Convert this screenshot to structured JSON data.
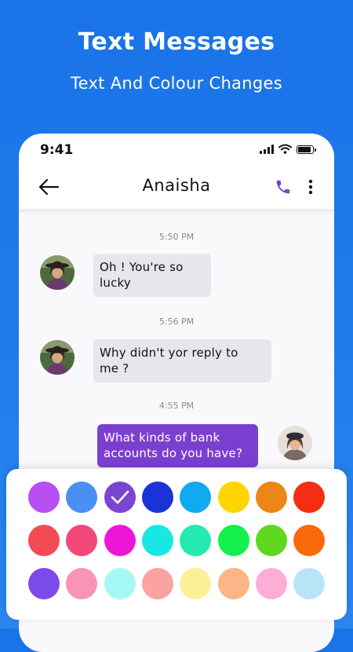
{
  "promo": {
    "title": "Text Messages",
    "subtitle": "Text And Colour Changes"
  },
  "status_bar": {
    "time": "9:41",
    "icons": [
      "signal-icon",
      "wifi-icon",
      "battery-icon"
    ]
  },
  "header": {
    "contact_name": "Anaisha",
    "back_icon": "back-arrow-icon",
    "call_icon": "phone-icon",
    "menu_icon": "more-vertical-icon",
    "accent_color": "#7b3fcf"
  },
  "messages": [
    {
      "time": "5:50 PM",
      "direction": "incoming",
      "lines": [
        "Oh ! You're so",
        "lucky"
      ]
    },
    {
      "time": "5:56 PM",
      "direction": "incoming",
      "lines": [
        "Why didn't  yor reply to",
        "me ?"
      ]
    },
    {
      "time": "4:55 PM",
      "direction": "outgoing",
      "lines": [
        "What kinds of bank",
        "accounts do you have?"
      ]
    }
  ],
  "palette": {
    "selected_index": 2,
    "colors": [
      "#b84ff2",
      "#4b8ff5",
      "#7a45d0",
      "#1933d9",
      "#11aaf0",
      "#ffd500",
      "#ed8618",
      "#f52e13",
      "#f24b55",
      "#f2497a",
      "#ee16d6",
      "#19e7e3",
      "#22eab0",
      "#13f04e",
      "#5fd81e",
      "#fa6a0d",
      "#7a4be8",
      "#fa94b4",
      "#a6f8f6",
      "#fba3a2",
      "#fbf096",
      "#fbb586",
      "#fcaed6",
      "#b9e4f8"
    ]
  }
}
